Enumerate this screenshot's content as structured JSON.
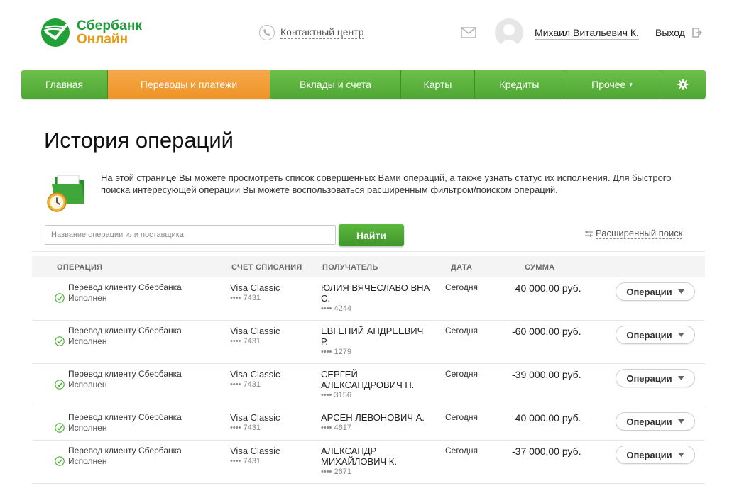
{
  "header": {
    "logo_line1": "Сбербанк",
    "logo_line2": "Онлайн",
    "contact_center": "Контактный центр",
    "user_name": "Михаил Витальевич К.",
    "logout": "Выход"
  },
  "nav": {
    "items": [
      {
        "label": "Главная",
        "active": false
      },
      {
        "label": "Переводы и платежи",
        "active": true
      },
      {
        "label": "Вклады и счета",
        "active": false
      },
      {
        "label": "Карты",
        "active": false
      },
      {
        "label": "Кредиты",
        "active": false
      },
      {
        "label": "Прочее",
        "active": false
      }
    ]
  },
  "page": {
    "title": "История операций",
    "intro": "На этой странице Вы можете просмотреть список совершенных Вами операций, а также узнать статус их исполнения. Для быстрого поиска интересующей операции Вы можете воспользоваться расширенным фильтром/поиском операций."
  },
  "search": {
    "placeholder": "Название операции или поставщика",
    "value": "",
    "button": "Найти",
    "advanced": "Расширенный поиск"
  },
  "table": {
    "headers": {
      "operation": "ОПЕРАЦИЯ",
      "account": "СЧЕТ СПИСАНИЯ",
      "recipient": "ПОЛУЧАТЕЛЬ",
      "date": "ДАТА",
      "amount": "СУММА"
    },
    "rows": [
      {
        "operation": "Перевод клиенту Сбербанка",
        "status": "Исполнен",
        "account": "Visa Classic",
        "account_num": "•••• 7431",
        "recipient": "ЮЛИЯ ВЯЧЕСЛАВО ВНА С.",
        "recipient_num": "•••• 4244",
        "date": "Сегодня",
        "amount": "-40 000,00 руб.",
        "action": "Операции"
      },
      {
        "operation": "Перевод клиенту Сбербанка",
        "status": "Исполнен",
        "account": "Visa Classic",
        "account_num": "•••• 7431",
        "recipient": "ЕВГЕНИЙ АНДРЕЕВИЧ Р.",
        "recipient_num": "•••• 1279",
        "date": "Сегодня",
        "amount": "-60 000,00 руб.",
        "action": "Операции"
      },
      {
        "operation": "Перевод клиенту Сбербанка",
        "status": "Исполнен",
        "account": "Visa Classic",
        "account_num": "•••• 7431",
        "recipient": "СЕРГЕЙ АЛЕКСАНДРОВИЧ П.",
        "recipient_num": "•••• 3156",
        "date": "Сегодня",
        "amount": "-39 000,00 руб.",
        "action": "Операции"
      },
      {
        "operation": "Перевод клиенту Сбербанка",
        "status": "Исполнен",
        "account": "Visa Classic",
        "account_num": "•••• 7431",
        "recipient": "АРСЕН ЛЕВОНОВИЧ А.",
        "recipient_num": "•••• 4617",
        "date": "Сегодня",
        "amount": "-40 000,00 руб.",
        "action": "Операции"
      },
      {
        "operation": "Перевод клиенту Сбербанка",
        "status": "Исполнен",
        "account": "Visa Classic",
        "account_num": "•••• 7431",
        "recipient": "АЛЕКСАНДР МИХАЙЛОВИЧ К.",
        "recipient_num": "•••• 2671",
        "date": "Сегодня",
        "amount": "-37 000,00 руб.",
        "action": "Операции"
      }
    ]
  },
  "colors": {
    "brand_green": "#1f9d3a",
    "brand_orange": "#e59a16",
    "nav_green": "#5cb33e",
    "nav_active": "#f09a32"
  },
  "icons": {
    "logo": "sberbank-logo-icon",
    "phone": "phone-icon",
    "mail": "mail-icon",
    "avatar": "user-avatar",
    "logout": "logout-icon",
    "settings": "gear-icon",
    "intro": "folder-clock-icon",
    "advanced_search": "filter-sliders-icon",
    "status": "check-circle-icon"
  }
}
